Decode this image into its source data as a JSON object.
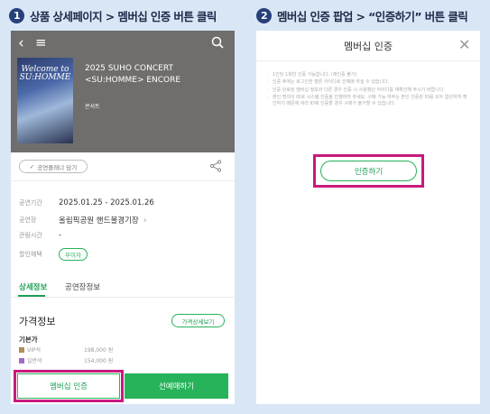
{
  "steps": [
    {
      "number": "1",
      "text": "상품 상세페이지 > 멤버십 인증 버튼 클릭"
    },
    {
      "number": "2",
      "text": "멤버십 인증 팝업 > “인증하기” 버튼 클릭"
    }
  ],
  "detail": {
    "poster_text": "Welcome to SU:HOMME",
    "title": "2025 SUHO CONCERT\n<SU:HOMME> ENCORE",
    "category": "콘서트",
    "wish_label": "공연플래너 담기",
    "info": [
      {
        "label": "공연기간",
        "value": "2025.01.25 - 2025.01.26"
      },
      {
        "label": "공연장",
        "value": "올림픽공원 핸드볼경기장",
        "has_chevron": true
      },
      {
        "label": "관람시간",
        "value": "-"
      },
      {
        "label": "할인혜택",
        "value": "무이자",
        "badge": true
      }
    ],
    "tabs": [
      "상세정보",
      "공연장정보"
    ],
    "price": {
      "title": "가격정보",
      "detail_button": "가격상세보기",
      "base_label": "기본가",
      "grades": [
        {
          "name": "VIP석",
          "price": "198,000 원",
          "color": "#b58a5c"
        },
        {
          "name": "일반석",
          "price": "154,000 원",
          "color": "#a46bc9"
        }
      ]
    },
    "buttons": {
      "membership": "멤버십 인증",
      "presale": "선예매하기"
    }
  },
  "popup": {
    "title": "멤버십 인증",
    "notes": [
      "1인당 1회만 인증 가능합니다. (재인증 불가)",
      "인증 후에는 로그인한 멜론 아이디로 선예매 하실 수 있습니다.",
      "인증 완료된 멤버십 정보와 다른 경우 인증 시 사용했던 아이디를 재확인해 주시기 바랍니다.",
      "본인 명의의 ID로 시스템 인증을 진행하여 주세요. 구매 가능 여부는 본인 인증된 ID를 모두 합산하여 확인하기 때문에 여러 ID에 인증할 경우 구매가 불가할 수 있습니다."
    ],
    "verify_button": "인증하기"
  },
  "colors": {
    "accent": "#27b35a",
    "highlight": "#c8197e",
    "step_badge": "#27407a",
    "background": "#d9e6f5"
  }
}
